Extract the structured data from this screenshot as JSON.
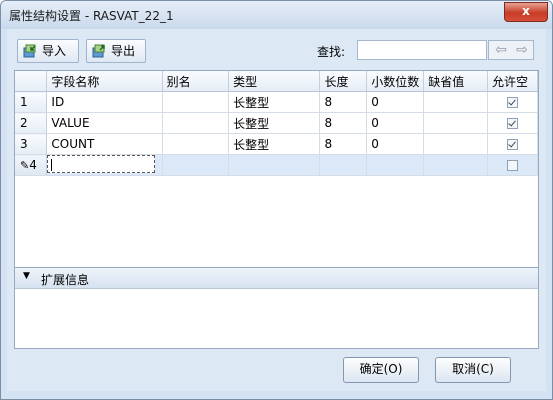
{
  "window": {
    "title": "属性结构设置 - RASVAT_22_1",
    "close_glyph": "x"
  },
  "toolbar": {
    "import_label": "导入",
    "export_label": "导出",
    "search_label": "查找:",
    "search_value": "",
    "prev_glyph": "⇦",
    "next_glyph": "⇨"
  },
  "grid": {
    "columns": [
      "",
      "字段名称",
      "别名",
      "类型",
      "长度",
      "小数位数",
      "缺省值",
      "允许空"
    ],
    "rows": [
      {
        "num": "1",
        "name": "ID",
        "alias": "",
        "type": "长整型",
        "length": "8",
        "decimals": "0",
        "default": "",
        "nullable": true
      },
      {
        "num": "2",
        "name": "VALUE",
        "alias": "",
        "type": "长整型",
        "length": "8",
        "decimals": "0",
        "default": "",
        "nullable": true
      },
      {
        "num": "3",
        "name": "COUNT",
        "alias": "",
        "type": "长整型",
        "length": "8",
        "decimals": "0",
        "default": "",
        "nullable": true
      }
    ],
    "new_row": {
      "marker": "✎",
      "num": "4",
      "nullable": false
    }
  },
  "extension": {
    "arrow_glyph": "▼",
    "label": "扩展信息"
  },
  "buttons": {
    "ok_label": "确定(O)",
    "cancel_label": "取消(C)"
  }
}
